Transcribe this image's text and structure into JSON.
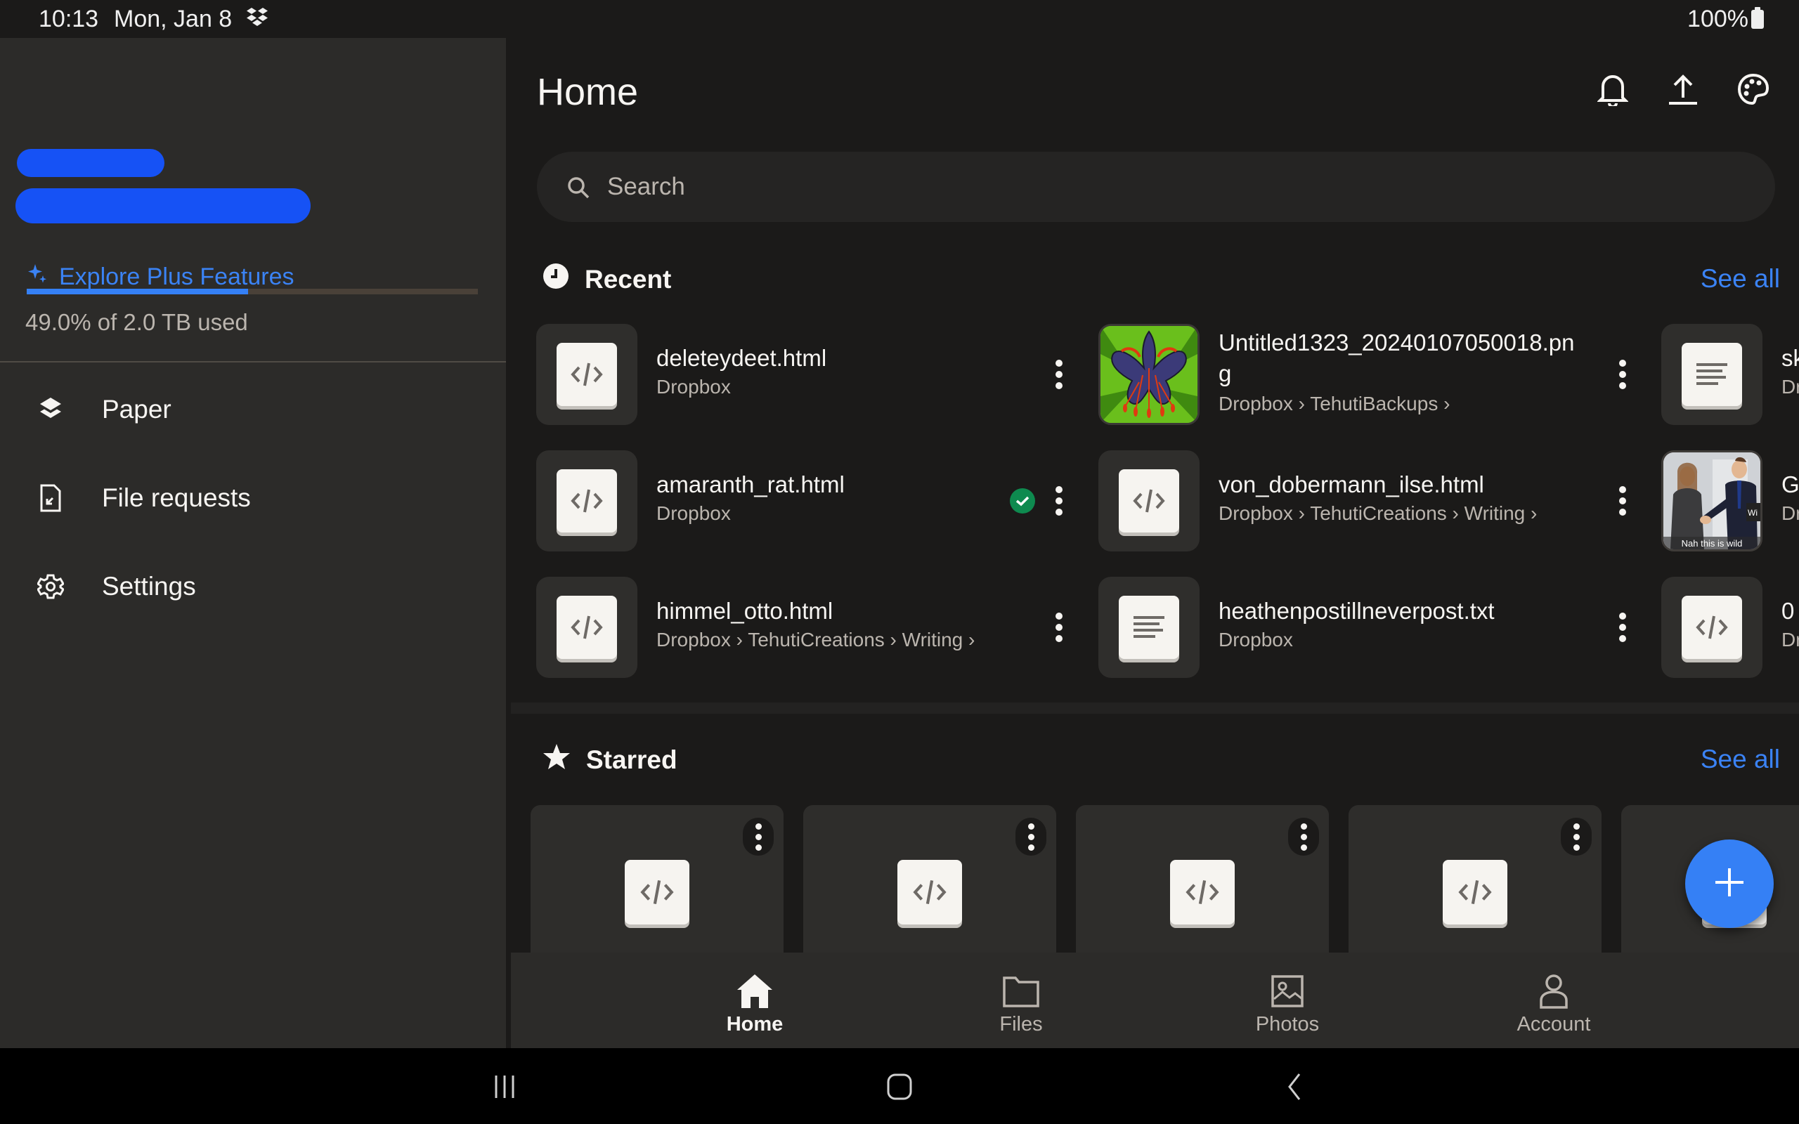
{
  "status_bar": {
    "time": "10:13",
    "date": "Mon, Jan 8",
    "notification_icon": "dropbox-icon",
    "battery": "100%"
  },
  "sidebar": {
    "account_name_redacted": true,
    "account_email_redacted": true,
    "explore_label": "Explore Plus Features",
    "storage": {
      "used_fraction": 0.49,
      "text": "49.0% of 2.0 TB used"
    },
    "items": [
      {
        "label": "Paper",
        "icon": "paper-icon"
      },
      {
        "label": "File requests",
        "icon": "file-request-icon"
      },
      {
        "label": "Settings",
        "icon": "gear-icon"
      }
    ]
  },
  "header": {
    "title": "Home",
    "icons": [
      "bell-icon",
      "upload-icon",
      "palette-icon"
    ]
  },
  "search": {
    "placeholder": "Search",
    "value": ""
  },
  "recent": {
    "title": "Recent",
    "see_all": "See all",
    "files": [
      {
        "name": "deleteydeet.html",
        "path": "Dropbox",
        "type": "html",
        "synced": false
      },
      {
        "name": "amaranth_rat.html",
        "path": "Dropbox",
        "type": "html",
        "synced": true
      },
      {
        "name": "himmel_otto.html",
        "path": "Dropbox › TehutiCreations › Writing ›",
        "type": "html",
        "synced": false
      },
      {
        "name": "Untitled1323_20240107050018.pn",
        "name_line2": "g",
        "path": "Dropbox › TehutiBackups ›",
        "type": "image-flower",
        "synced": false
      },
      {
        "name": "von_dobermann_ilse.html",
        "path": "Dropbox › TehutiCreations › Writing ›",
        "type": "html",
        "synced": false
      },
      {
        "name": "heathenpostillneverpost.txt",
        "path": "Dropbox",
        "type": "text",
        "synced": false
      },
      {
        "name": "sk",
        "path": "Dr",
        "type": "text",
        "synced": false
      },
      {
        "name": "G",
        "path": "Dr",
        "type": "image-meme",
        "caption": "Nah this is wild",
        "synced": false
      },
      {
        "name": "0",
        "path": "Dr",
        "type": "html",
        "synced": false
      }
    ]
  },
  "starred": {
    "title": "Starred",
    "see_all": "See all",
    "cards": [
      {
        "type": "html"
      },
      {
        "type": "html"
      },
      {
        "type": "html"
      },
      {
        "type": "html"
      },
      {
        "type": "html"
      }
    ]
  },
  "fab": {
    "icon": "plus-icon"
  },
  "bottom_nav": [
    {
      "label": "Home",
      "icon": "home-icon",
      "active": true
    },
    {
      "label": "Files",
      "icon": "folder-icon",
      "active": false
    },
    {
      "label": "Photos",
      "icon": "photos-icon",
      "active": false
    },
    {
      "label": "Account",
      "icon": "account-icon",
      "active": false
    }
  ],
  "android_nav": [
    "recents-icon",
    "home-circle-icon",
    "back-icon"
  ],
  "colors": {
    "accent": "#3580f5",
    "synced": "#0e8a4f",
    "background": "#1b1a19",
    "sidebar": "#2c2b29"
  }
}
